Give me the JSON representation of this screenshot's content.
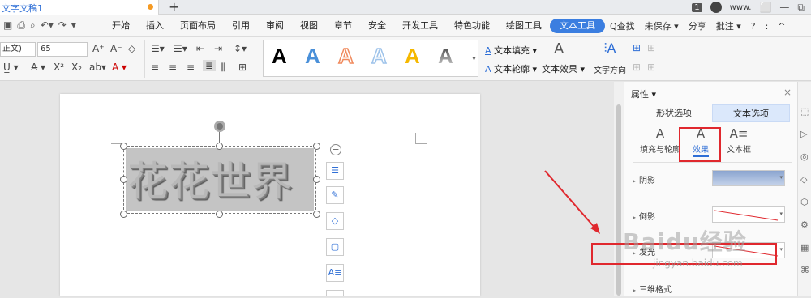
{
  "titlebar": {
    "doc_name": "文字文稿1",
    "new_tab": "+",
    "badge": "1",
    "user": "www.",
    "window_controls": [
      "⬜",
      "—",
      "⧉"
    ]
  },
  "menu": {
    "items": [
      "开始",
      "插入",
      "页面布局",
      "引用",
      "审阅",
      "视图",
      "章节",
      "安全",
      "开发工具",
      "特色功能",
      "绘图工具",
      "文本工具"
    ],
    "active": "文本工具",
    "find": "Q查找",
    "right": [
      "未保存 ▾",
      "分享",
      "批注 ▾",
      "?",
      ":",
      "^"
    ]
  },
  "ribbon": {
    "font_name": "正文)",
    "font_size": "65",
    "styles": [
      {
        "letter": "A",
        "color": "#000000"
      },
      {
        "letter": "A",
        "color": "#4a90d9"
      },
      {
        "letter": "A",
        "color": "#f08a5d"
      },
      {
        "letter": "A",
        "color": "#9ec3ea"
      },
      {
        "letter": "A",
        "color": "#f5b800"
      },
      {
        "letter": "A",
        "color": "#888888"
      }
    ],
    "text_fill": "文本填充",
    "text_outline": "文本轮廓",
    "text_effect": "文本效果",
    "text_direction": "文字方向"
  },
  "document": {
    "wordart_text": "花花世界"
  },
  "panel": {
    "title": "属性 ▾",
    "close": "×",
    "tabs": [
      "形状选项",
      "文本选项"
    ],
    "active_tab": "文本选项",
    "sub_options": [
      {
        "label": "填充与轮廓",
        "icon": "A"
      },
      {
        "label": "效果",
        "icon": "A"
      },
      {
        "label": "文本框",
        "icon": "A≡"
      }
    ],
    "active_sub": "效果",
    "rows": [
      "阴影",
      "倒影",
      "发光",
      "三维格式"
    ]
  },
  "watermark": {
    "text": "Baidu经验",
    "url": "jingyan.baidu.com"
  },
  "colors": {
    "accent": "#3b7ee0",
    "annotation": "#e0282e"
  }
}
